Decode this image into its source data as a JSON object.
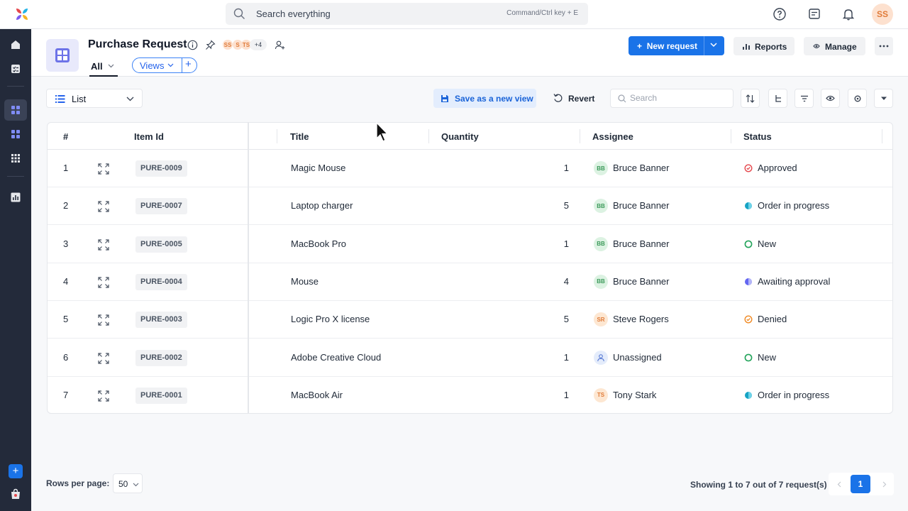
{
  "topbar": {
    "search_placeholder": "Search everything",
    "search_hint": "Command/Ctrl key + E",
    "user_initials": "SS"
  },
  "header": {
    "title": "Purchase Request",
    "collaborators": [
      "SS",
      "S",
      "TS"
    ],
    "more_collaborators": "+4",
    "tab_all": "All",
    "views_label": "Views",
    "views_add": "+",
    "new_request_label": "New request",
    "reports_label": "Reports",
    "manage_label": "Manage"
  },
  "toolbar": {
    "view_type": "List",
    "save_view_label": "Save as a new view",
    "revert_label": "Revert",
    "search_placeholder": "Search"
  },
  "table": {
    "columns": [
      "#",
      "Item Id",
      "Title",
      "Quantity",
      "Assignee",
      "Status"
    ],
    "rows": [
      {
        "num": "1",
        "item_id": "PURE-0009",
        "title": "Magic Mouse",
        "quantity": "1",
        "assignee_initials": "BB",
        "assignee": "Bruce Banner",
        "status": "Approved",
        "status_kind": "approved"
      },
      {
        "num": "2",
        "item_id": "PURE-0007",
        "title": "Laptop charger",
        "quantity": "5",
        "assignee_initials": "BB",
        "assignee": "Bruce Banner",
        "status": "Order in progress",
        "status_kind": "progress"
      },
      {
        "num": "3",
        "item_id": "PURE-0005",
        "title": "MacBook Pro",
        "quantity": "1",
        "assignee_initials": "BB",
        "assignee": "Bruce Banner",
        "status": "New",
        "status_kind": "new"
      },
      {
        "num": "4",
        "item_id": "PURE-0004",
        "title": "Mouse",
        "quantity": "4",
        "assignee_initials": "BB",
        "assignee": "Bruce Banner",
        "status": "Awaiting approval",
        "status_kind": "awaiting"
      },
      {
        "num": "5",
        "item_id": "PURE-0003",
        "title": "Logic Pro X license",
        "quantity": "5",
        "assignee_initials": "SR",
        "assignee": "Steve Rogers",
        "status": "Denied",
        "status_kind": "denied"
      },
      {
        "num": "6",
        "item_id": "PURE-0002",
        "title": "Adobe Creative Cloud",
        "quantity": "1",
        "assignee_initials": "",
        "assignee": "Unassigned",
        "status": "New",
        "status_kind": "new"
      },
      {
        "num": "7",
        "item_id": "PURE-0001",
        "title": "MacBook Air",
        "quantity": "1",
        "assignee_initials": "TS",
        "assignee": "Tony Stark",
        "status": "Order in progress",
        "status_kind": "progress"
      }
    ]
  },
  "footer": {
    "rows_per_page_label": "Rows per page:",
    "rows_per_page": "50",
    "showing": "Showing 1 to 7 out of 7 request(s)",
    "current_page": "1"
  },
  "colors": {
    "primary": "#1a73e8",
    "sidebar_bg": "#232a3a",
    "approved": "#e5484d",
    "progress": "#16a3c4",
    "new": "#22a35a",
    "awaiting": "#6366f1",
    "denied": "#f08a24"
  }
}
